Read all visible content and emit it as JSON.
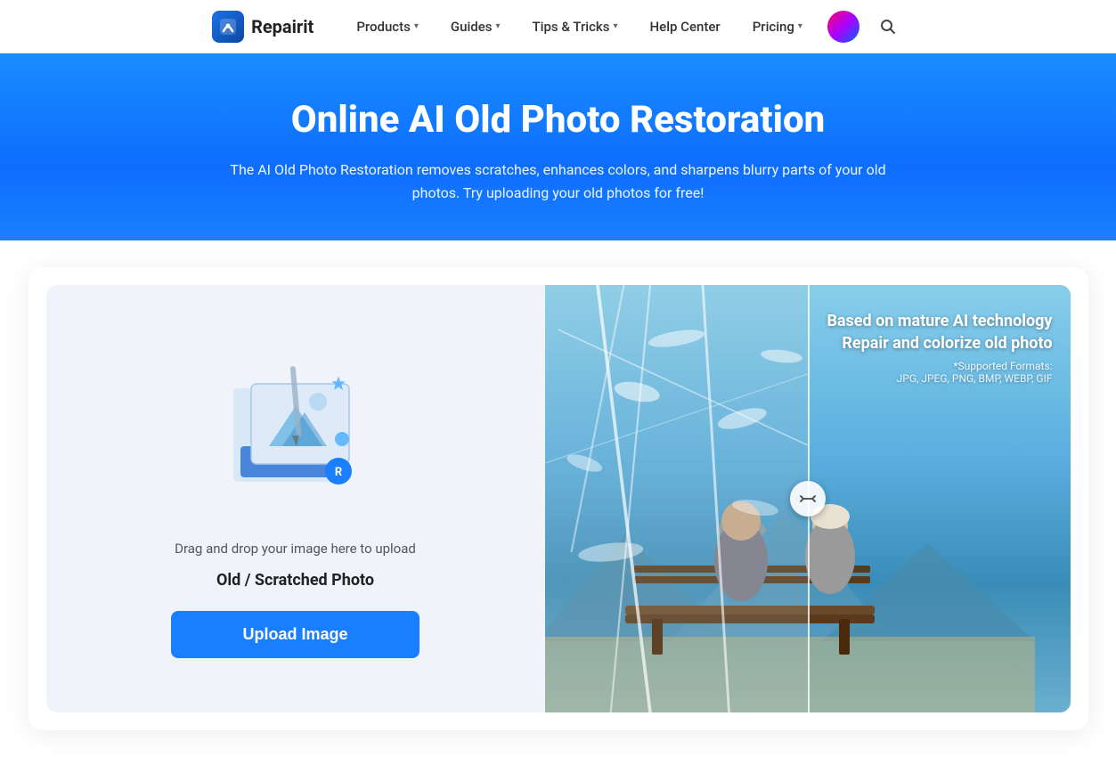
{
  "navbar": {
    "logo_text": "Repairit",
    "items": [
      {
        "label": "Products",
        "has_dropdown": true
      },
      {
        "label": "Guides",
        "has_dropdown": true
      },
      {
        "label": "Tips & Tricks",
        "has_dropdown": true
      },
      {
        "label": "Help Center",
        "has_dropdown": false
      },
      {
        "label": "Pricing",
        "has_dropdown": true
      }
    ]
  },
  "hero": {
    "title": "Online AI Old Photo Restoration",
    "subtitle": "The AI Old Photo Restoration removes scratches, enhances colors, and sharpens blurry parts of your old photos. Try uploading your old photos for free!"
  },
  "upload_panel": {
    "drag_text": "Drag and drop your image here to upload",
    "label": "Old / Scratched Photo",
    "button_label": "Upload Image"
  },
  "preview_panel": {
    "line1": "Based on mature AI technology",
    "line2": "Repair and colorize old photo",
    "formats_label": "*Supported Formats:",
    "formats_list": "JPG, JPEG, PNG, BMP, WEBP, GIF"
  }
}
